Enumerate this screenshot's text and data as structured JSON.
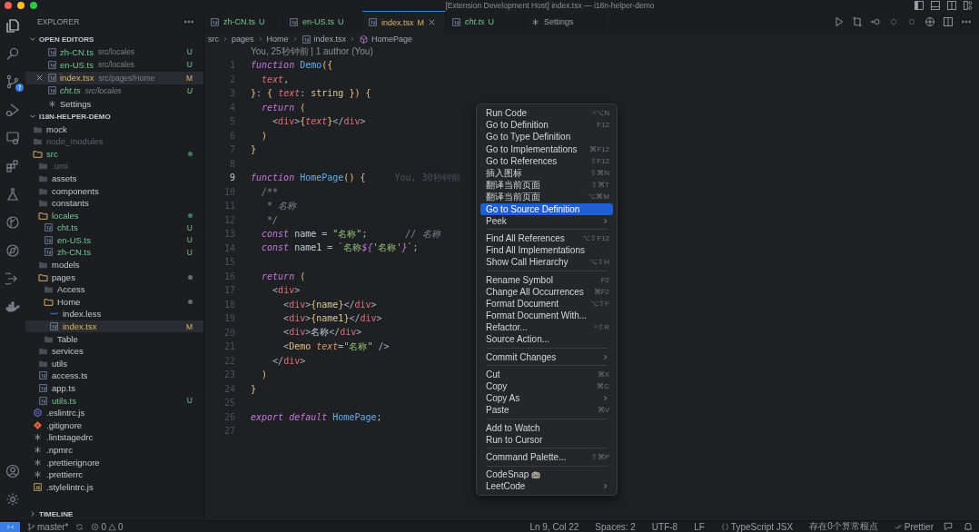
{
  "window": {
    "title": "[Extension Development Host] index.tsx — i18n-helper-demo"
  },
  "activity_bar": {
    "items": [
      {
        "kind": "files",
        "selected": true
      },
      {
        "kind": "search",
        "selected": false
      },
      {
        "kind": "source-control",
        "selected": false,
        "badge": "7"
      },
      {
        "kind": "run",
        "selected": false
      },
      {
        "kind": "remote",
        "selected": false
      },
      {
        "kind": "extensions",
        "selected": false
      },
      {
        "kind": "testing",
        "selected": false
      },
      {
        "kind": "graph",
        "selected": false
      },
      {
        "kind": "compass",
        "selected": false
      },
      {
        "kind": "share",
        "selected": false
      },
      {
        "kind": "docker",
        "selected": false
      }
    ],
    "bottom": [
      {
        "kind": "account"
      },
      {
        "kind": "settings"
      }
    ]
  },
  "sidebar": {
    "title": "EXPLORER",
    "open_editors": {
      "title": "OPEN EDITORS",
      "expanded": true,
      "items": [
        {
          "name": "zh-CN.ts",
          "path": "src/locales",
          "status": "U",
          "kind": "ts",
          "selected": false,
          "preview": false
        },
        {
          "name": "en-US.ts",
          "path": "src/locales",
          "status": "U",
          "kind": "ts",
          "selected": false,
          "preview": false
        },
        {
          "name": "index.tsx",
          "path": "src/pages/Home",
          "status": "M",
          "kind": "ts",
          "selected": true,
          "preview": false
        },
        {
          "name": "cht.ts",
          "path": "src/locales",
          "status": "U",
          "kind": "ts",
          "selected": false,
          "preview": true
        },
        {
          "name": "Settings",
          "kind": "gear",
          "selected": false,
          "preview": false
        }
      ]
    },
    "project": {
      "title": "I18N-HELPER-DEMO",
      "expanded": true,
      "items": [
        {
          "name": "mock",
          "kind": "folder",
          "expanded": false,
          "selected": false
        },
        {
          "name": "node_modules",
          "kind": "folder",
          "expanded": false,
          "ignored": true,
          "selected": false
        },
        {
          "name": "src",
          "kind": "folder",
          "expanded": true,
          "untracked": true,
          "color": "#3f7d55",
          "selected": false,
          "children": [
            {
              "name": ".umi",
              "kind": "folder",
              "expanded": false,
              "ignored": true,
              "selected": false
            },
            {
              "name": "assets",
              "kind": "folder",
              "expanded": false,
              "selected": false
            },
            {
              "name": "components",
              "kind": "folder",
              "expanded": false,
              "selected": false
            },
            {
              "name": "constants",
              "kind": "folder",
              "expanded": false,
              "selected": false
            },
            {
              "name": "locales",
              "kind": "folder",
              "expanded": true,
              "untracked": true,
              "color": "#3f7d55",
              "selected": false,
              "children": [
                {
                  "name": "cht.ts",
                  "kind": "ts",
                  "status": "U",
                  "selected": false
                },
                {
                  "name": "en-US.ts",
                  "kind": "ts",
                  "status": "U",
                  "selected": false
                },
                {
                  "name": "zh-CN.ts",
                  "kind": "ts",
                  "status": "U",
                  "selected": false
                }
              ]
            },
            {
              "name": "models",
              "kind": "folder",
              "expanded": false,
              "selected": false
            },
            {
              "name": "pages",
              "kind": "folder",
              "expanded": true,
              "color": "#6a6d74",
              "selected": false,
              "children": [
                {
                  "name": "Access",
                  "kind": "folder",
                  "expanded": false,
                  "selected": false
                },
                {
                  "name": "Home",
                  "kind": "folder",
                  "expanded": true,
                  "color": "#6a6d74",
                  "selected": false,
                  "children": [
                    {
                      "name": "index.less",
                      "kind": "less",
                      "selected": false
                    },
                    {
                      "name": "index.tsx",
                      "kind": "ts",
                      "status": "M",
                      "selected": true
                    }
                  ]
                },
                {
                  "name": "Table",
                  "kind": "folder",
                  "expanded": false,
                  "selected": false
                }
              ]
            },
            {
              "name": "services",
              "kind": "folder",
              "expanded": false,
              "selected": false
            },
            {
              "name": "utils",
              "kind": "folder",
              "expanded": false,
              "selected": false
            },
            {
              "name": "access.ts",
              "kind": "ts",
              "selected": false
            },
            {
              "name": "app.ts",
              "kind": "ts",
              "selected": false
            },
            {
              "name": "utils.ts",
              "kind": "ts",
              "status": "U",
              "selected": false
            }
          ]
        },
        {
          "name": ".eslintrc.js",
          "kind": "eslint",
          "selected": false
        },
        {
          "name": ".gitignore",
          "kind": "git",
          "selected": false
        },
        {
          "name": ".lintstagedrc",
          "kind": "config",
          "selected": false
        },
        {
          "name": ".npmrc",
          "kind": "config",
          "selected": false
        },
        {
          "name": ".prettierignore",
          "kind": "config",
          "selected": false
        },
        {
          "name": ".prettierrc",
          "kind": "config",
          "selected": false
        },
        {
          "name": ".stylelintrc.js",
          "kind": "js",
          "selected": false
        }
      ]
    },
    "timeline": {
      "title": "TIMELINE",
      "expanded": false
    }
  },
  "tabs": [
    {
      "label": "zh-CN.ts",
      "status": "U",
      "kind": "ts",
      "selected": false,
      "preview": false
    },
    {
      "label": "en-US.ts",
      "status": "U",
      "kind": "ts",
      "selected": false,
      "preview": false
    },
    {
      "label": "index.tsx",
      "status": "M",
      "kind": "ts",
      "selected": true,
      "preview": false
    },
    {
      "label": "cht.ts",
      "status": "U",
      "kind": "ts",
      "selected": false,
      "preview": true
    },
    {
      "label": "Settings",
      "kind": "gear",
      "selected": false,
      "preview": false
    }
  ],
  "breadcrumb": [
    {
      "label": "src"
    },
    {
      "label": "pages"
    },
    {
      "label": "Home"
    },
    {
      "label": "index.tsx",
      "kind": "ts"
    },
    {
      "label": "HomePage",
      "kind": "symbol"
    }
  ],
  "editor": {
    "codelens": "You, 25秒钟前 | 1 author (You)",
    "lines": [
      {
        "number": "1",
        "current": false,
        "tokens": [
          {
            "kind": "kw",
            "text": "function "
          },
          {
            "kind": "fn",
            "text": "Demo"
          },
          {
            "kind": "brace",
            "text": "({"
          }
        ]
      },
      {
        "number": "2",
        "current": false,
        "tokens": [
          {
            "kind": "param",
            "text": "  text"
          },
          {
            "kind": "punc",
            "text": ","
          }
        ]
      },
      {
        "number": "3",
        "current": false,
        "tokens": [
          {
            "kind": "brace",
            "text": "}"
          },
          {
            "kind": "punc",
            "text": ": "
          },
          {
            "kind": "brace",
            "text": "{ "
          },
          {
            "kind": "param",
            "text": "text"
          },
          {
            "kind": "punc",
            "text": ": "
          },
          {
            "kind": "type",
            "text": "string"
          },
          {
            "kind": "brace",
            "text": " }) {"
          }
        ]
      },
      {
        "number": "4",
        "current": false,
        "tokens": [
          {
            "kind": "kw",
            "text": "  return "
          },
          {
            "kind": "brace",
            "text": "("
          }
        ]
      },
      {
        "number": "5",
        "current": false,
        "tokens": [
          {
            "kind": "punc",
            "text": "    <"
          },
          {
            "kind": "tag",
            "text": "div"
          },
          {
            "kind": "punc",
            "text": ">"
          },
          {
            "kind": "brace",
            "text": "{"
          },
          {
            "kind": "param",
            "text": "text"
          },
          {
            "kind": "brace",
            "text": "}"
          },
          {
            "kind": "punc",
            "text": "</"
          },
          {
            "kind": "tag",
            "text": "div"
          },
          {
            "kind": "punc",
            "text": ">"
          }
        ]
      },
      {
        "number": "6",
        "current": false,
        "tokens": [
          {
            "kind": "brace",
            "text": "  )"
          }
        ]
      },
      {
        "number": "7",
        "current": false,
        "tokens": [
          {
            "kind": "brace",
            "text": "}"
          }
        ]
      },
      {
        "number": "8",
        "current": false
      },
      {
        "number": "9",
        "current": true,
        "blame": "You, 30秒钟前",
        "tokens": [
          {
            "kind": "kw",
            "text": "function "
          },
          {
            "kind": "fn",
            "text": "HomePage"
          },
          {
            "kind": "brace",
            "text": "() {"
          }
        ]
      },
      {
        "number": "10",
        "current": false,
        "tokens": [
          {
            "kind": "cmt",
            "text": "  /**"
          }
        ]
      },
      {
        "number": "11",
        "current": false,
        "tokens": [
          {
            "kind": "cmt",
            "text": "   * 名称"
          }
        ]
      },
      {
        "number": "12",
        "current": false,
        "tokens": [
          {
            "kind": "cmt",
            "text": "   */"
          }
        ]
      },
      {
        "number": "13",
        "current": false,
        "tokens": [
          {
            "kind": "kw",
            "text": "  const "
          },
          {
            "kind": "plain",
            "text": "name "
          },
          {
            "kind": "punc",
            "text": "= "
          },
          {
            "kind": "str",
            "text": "\"名称\""
          },
          {
            "kind": "punc",
            "text": ";"
          },
          {
            "kind": "cmt",
            "text": "       // 名称"
          }
        ]
      },
      {
        "number": "14",
        "current": false,
        "tokens": [
          {
            "kind": "kw",
            "text": "  const "
          },
          {
            "kind": "plain",
            "text": "name1 "
          },
          {
            "kind": "punc",
            "text": "= "
          },
          {
            "kind": "str",
            "text": "`名称"
          },
          {
            "kind": "kw",
            "text": "${"
          },
          {
            "kind": "str",
            "text": "'名称'"
          },
          {
            "kind": "kw",
            "text": "}"
          },
          {
            "kind": "str",
            "text": "`"
          },
          {
            "kind": "punc",
            "text": ";"
          }
        ]
      },
      {
        "number": "15",
        "current": false
      },
      {
        "number": "16",
        "current": false,
        "tokens": [
          {
            "kind": "kw",
            "text": "  return "
          },
          {
            "kind": "brace",
            "text": "("
          }
        ]
      },
      {
        "number": "17",
        "current": false,
        "tokens": [
          {
            "kind": "punc",
            "text": "    <"
          },
          {
            "kind": "tag",
            "text": "div"
          },
          {
            "kind": "punc",
            "text": ">"
          }
        ]
      },
      {
        "number": "18",
        "current": false,
        "tokens": [
          {
            "kind": "punc",
            "text": "      <"
          },
          {
            "kind": "tag",
            "text": "div"
          },
          {
            "kind": "punc",
            "text": ">"
          },
          {
            "kind": "brace",
            "text": "{"
          },
          {
            "kind": "type",
            "text": "name"
          },
          {
            "kind": "brace",
            "text": "}"
          },
          {
            "kind": "punc",
            "text": "</"
          },
          {
            "kind": "tag",
            "text": "div"
          },
          {
            "kind": "punc",
            "text": ">"
          }
        ]
      },
      {
        "number": "19",
        "current": false,
        "tokens": [
          {
            "kind": "punc",
            "text": "      <"
          },
          {
            "kind": "tag",
            "text": "div"
          },
          {
            "kind": "punc",
            "text": ">"
          },
          {
            "kind": "brace",
            "text": "{"
          },
          {
            "kind": "type",
            "text": "name1"
          },
          {
            "kind": "brace",
            "text": "}"
          },
          {
            "kind": "punc",
            "text": "</"
          },
          {
            "kind": "tag",
            "text": "div"
          },
          {
            "kind": "punc",
            "text": ">"
          }
        ]
      },
      {
        "number": "20",
        "current": false,
        "tokens": [
          {
            "kind": "punc",
            "text": "      <"
          },
          {
            "kind": "tag",
            "text": "div"
          },
          {
            "kind": "punc",
            "text": ">"
          },
          {
            "kind": "plain",
            "text": "名称"
          },
          {
            "kind": "punc",
            "text": "</"
          },
          {
            "kind": "tag",
            "text": "div"
          },
          {
            "kind": "punc",
            "text": ">"
          }
        ]
      },
      {
        "number": "21",
        "current": false,
        "tokens": [
          {
            "kind": "punc",
            "text": "      <"
          },
          {
            "kind": "cls",
            "text": "Demo"
          },
          {
            "kind": "attr",
            "text": " text"
          },
          {
            "kind": "punc",
            "text": "="
          },
          {
            "kind": "str",
            "text": "\"名称\""
          },
          {
            "kind": "punc",
            "text": " />"
          }
        ]
      },
      {
        "number": "22",
        "current": false,
        "tokens": [
          {
            "kind": "punc",
            "text": "    </"
          },
          {
            "kind": "tag",
            "text": "div"
          },
          {
            "kind": "punc",
            "text": ">"
          }
        ]
      },
      {
        "number": "23",
        "current": false,
        "tokens": [
          {
            "kind": "brace",
            "text": "  )"
          }
        ]
      },
      {
        "number": "24",
        "current": false,
        "tokens": [
          {
            "kind": "brace",
            "text": "}"
          }
        ]
      },
      {
        "number": "25",
        "current": false
      },
      {
        "number": "26",
        "current": false,
        "tokens": [
          {
            "kind": "kw",
            "text": "export default "
          },
          {
            "kind": "fn",
            "text": "HomePage"
          },
          {
            "kind": "punc",
            "text": ";"
          }
        ]
      },
      {
        "number": "27",
        "current": false
      }
    ]
  },
  "context_menu": {
    "groups": [
      [
        {
          "label": "Run Code",
          "shortcut": "^⌥N",
          "selected": false
        },
        {
          "label": "Go to Definition",
          "shortcut": "F12",
          "selected": false
        },
        {
          "label": "Go to Type Definition",
          "selected": false
        },
        {
          "label": "Go to Implementations",
          "shortcut": "⌘F12",
          "selected": false
        },
        {
          "label": "Go to References",
          "shortcut": "⇧F12",
          "selected": false
        },
        {
          "label": "插入图标",
          "shortcut": "⇧⌘N",
          "selected": false
        },
        {
          "label": "翻译当前页面",
          "shortcut": "⇧⌘T",
          "selected": false
        },
        {
          "label": "翻译当前页面",
          "shortcut": "⌥⌘M",
          "selected": false
        },
        {
          "label": "Go to Source Definition",
          "selected": true
        },
        {
          "label": "Peek",
          "submenu": true,
          "selected": false
        }
      ],
      [
        {
          "label": "Find All References",
          "shortcut": "⌥⇧F12",
          "selected": false
        },
        {
          "label": "Find All Implementations",
          "selected": false
        },
        {
          "label": "Show Call Hierarchy",
          "shortcut": "⌥⇧H",
          "selected": false
        }
      ],
      [
        {
          "label": "Rename Symbol",
          "shortcut": "F2",
          "selected": false
        },
        {
          "label": "Change All Occurrences",
          "shortcut": "⌘F2",
          "selected": false
        },
        {
          "label": "Format Document",
          "shortcut": "⌥⇧F",
          "selected": false
        },
        {
          "label": "Format Document With...",
          "selected": false
        },
        {
          "label": "Refactor...",
          "shortcut": "^⇧R",
          "selected": false
        },
        {
          "label": "Source Action...",
          "selected": false
        }
      ],
      [
        {
          "label": "Commit Changes",
          "submenu": true,
          "selected": false
        }
      ],
      [
        {
          "label": "Cut",
          "shortcut": "⌘X",
          "selected": false
        },
        {
          "label": "Copy",
          "shortcut": "⌘C",
          "selected": false
        },
        {
          "label": "Copy As",
          "submenu": true,
          "selected": false
        },
        {
          "label": "Paste",
          "shortcut": "⌘V",
          "selected": false
        }
      ],
      [
        {
          "label": "Add to Watch",
          "selected": false
        },
        {
          "label": "Run to Cursor",
          "selected": false
        }
      ],
      [
        {
          "label": "Command Palette...",
          "shortcut": "⇧⌘P",
          "selected": false
        }
      ],
      [
        {
          "label": "CodeSnap",
          "kind": "camera",
          "selected": false
        },
        {
          "label": "LeetCode",
          "submenu": true,
          "selected": false
        }
      ]
    ]
  },
  "status_bar": {
    "branch": "master*",
    "errors": "0",
    "warnings": "0",
    "right": [
      {
        "text": "Ln 9, Col 22"
      },
      {
        "text": "Spaces: 2"
      },
      {
        "text": "UTF-8"
      },
      {
        "text": "LF"
      },
      {
        "text": "TypeScript JSX",
        "kind": "braces"
      },
      {
        "text": "存在0个算常根点"
      },
      {
        "text": "Prettier",
        "kind": "check"
      }
    ]
  }
}
